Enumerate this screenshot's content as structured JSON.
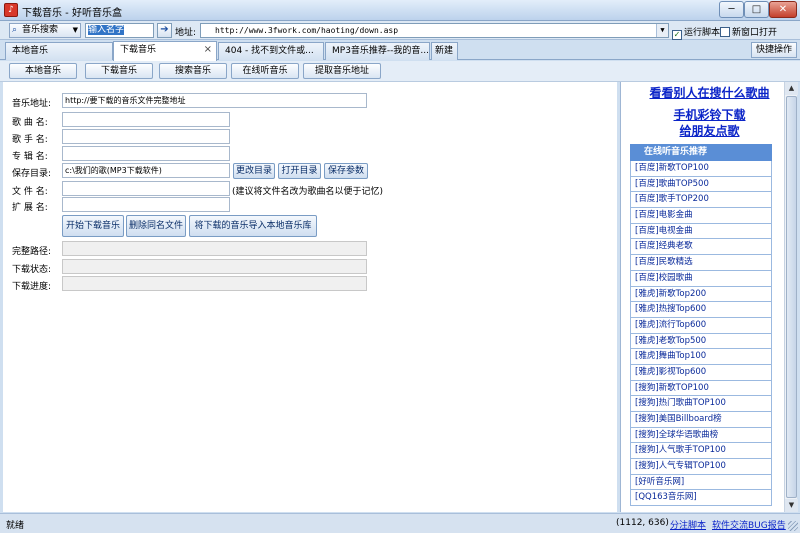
{
  "window": {
    "title": "下载音乐 - 好听音乐盒",
    "app_icon_glyph": "♪",
    "min": "─",
    "max": "□",
    "close": "✕"
  },
  "addressbar": {
    "search_dropdown": "音乐搜索",
    "search_value": "输入名字",
    "address_label": "地址:",
    "address_value": "http://www.3fwork.com/haoting/down.asp",
    "run_script": "运行脚本",
    "new_window": "新窗口打开"
  },
  "tabs": [
    {
      "label": "本地音乐"
    },
    {
      "label": "下载音乐"
    },
    {
      "label": "404 - 找不到文件或..."
    },
    {
      "label": "MP3音乐推荐--我的音..."
    },
    {
      "label": "新建"
    }
  ],
  "shortcut": "快捷操作",
  "subnav": [
    "本地音乐",
    "下载音乐",
    "搜索音乐",
    "在线听音乐",
    "提取音乐地址"
  ],
  "form": {
    "music_url_label": "音乐地址:",
    "music_url_value": "http://要下载的音乐文件完整地址",
    "song_label": "歌 曲 名:",
    "singer_label": "歌 手 名:",
    "album_label": "专 辑 名:",
    "save_dir_label": "保存目录:",
    "save_dir_value": "c:\\我们的歌(MP3下载软件)",
    "change_dir": "更改目录",
    "open_dir": "打开目录",
    "save_params": "保存参数",
    "filename_label": "文 件 名:",
    "filename_hint": "(建议将文件名改为歌曲名以便于记忆)",
    "ext_label": "扩 展 名:",
    "start_download": "开始下载音乐",
    "delete_same": "删除同名文件",
    "import_local": "将下载的音乐导入本地音乐库",
    "full_path_label": "完整路径:",
    "status_label": "下载状态:",
    "progress_label": "下载进度:"
  },
  "right": {
    "headline": "看看别人在搜什么歌曲",
    "promo_line1": "手机彩铃下载",
    "promo_line2": "给朋友点歌",
    "rec_title": "在线听音乐推荐",
    "items": [
      "[百度]新歌TOP100",
      "[百度]歌曲TOP500",
      "[百度]歌手TOP200",
      "[百度]电影金曲",
      "[百度]电视金曲",
      "[百度]经典老歌",
      "[百度]民歌精选",
      "[百度]校园歌曲",
      "[雅虎]新歌Top200",
      "[雅虎]热搜Top600",
      "[雅虎]流行Top600",
      "[雅虎]老歌Top500",
      "[雅虎]舞曲Top100",
      "[雅虎]影视Top600",
      "[搜狗]新歌TOP100",
      "[搜狗]热门歌曲TOP100",
      "[搜狗]美国Billboard榜",
      "[搜狗]全球华语歌曲榜",
      "[搜狗]人气歌手TOP100",
      "[搜狗]人气专辑TOP100",
      "[好听音乐网]",
      "[QQ163音乐网]"
    ]
  },
  "status": {
    "text": "就绪",
    "coords": "(1112, 636)",
    "link1": "分注脚本",
    "link2": "软件交流BUG报告"
  }
}
